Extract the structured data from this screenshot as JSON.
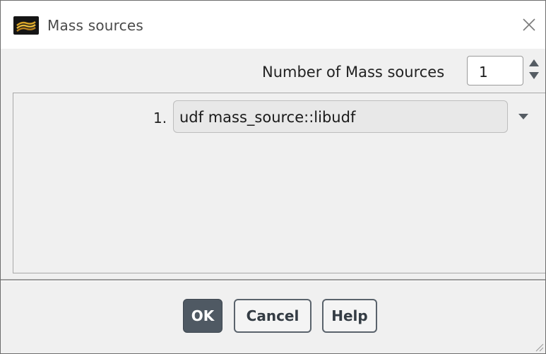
{
  "window": {
    "title": "Mass sources",
    "icon": "ansys-fluent-app-icon",
    "close_icon": "close-icon"
  },
  "number_of_sources": {
    "label": "Number of Mass sources",
    "value": "1"
  },
  "sources": [
    {
      "index": "1.",
      "value": "udf mass_source::libudf"
    }
  ],
  "buttons": {
    "ok": "OK",
    "cancel": "Cancel",
    "help": "Help"
  }
}
